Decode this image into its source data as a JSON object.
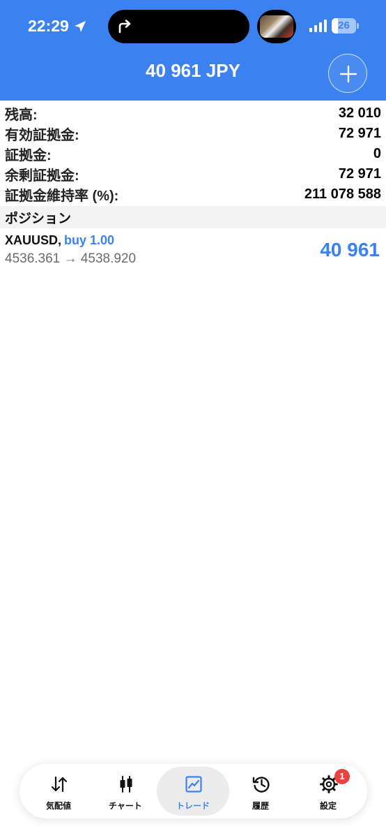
{
  "status_bar": {
    "time": "22:29",
    "battery_level": "26",
    "icons": [
      "location-arrow-icon",
      "forward-arrow-icon",
      "signal-icon",
      "battery-icon"
    ]
  },
  "header": {
    "title": "40 961 JPY",
    "add_icon": "plus-icon"
  },
  "summary": [
    {
      "label": "残高:",
      "value": "32 010"
    },
    {
      "label": "有効証拠金:",
      "value": "72 971"
    },
    {
      "label": "証拠金:",
      "value": "0"
    },
    {
      "label": "余剰証拠金:",
      "value": "72 971"
    },
    {
      "label": "証拠金維持率 (%):",
      "value": "211 078 588"
    }
  ],
  "positions_section": {
    "title": "ポジション",
    "items": [
      {
        "symbol": "XAUUSD,",
        "side": "buy 1.00",
        "open_price": "4536.361",
        "arrow": "→",
        "current_price": "4538.920",
        "profit": "40 961"
      }
    ]
  },
  "tabbar": {
    "tabs": [
      {
        "label": "気配値",
        "icon": "quotes-arrows-icon"
      },
      {
        "label": "チャート",
        "icon": "candlestick-icon"
      },
      {
        "label": "トレード",
        "icon": "trade-chart-icon"
      },
      {
        "label": "履歴",
        "icon": "history-clock-icon"
      },
      {
        "label": "設定",
        "icon": "settings-gear-icon"
      }
    ],
    "active_tab": "トレード",
    "settings_badge": "1"
  },
  "colors": {
    "accent": "#3b82f0",
    "badge": "#e9423e"
  }
}
